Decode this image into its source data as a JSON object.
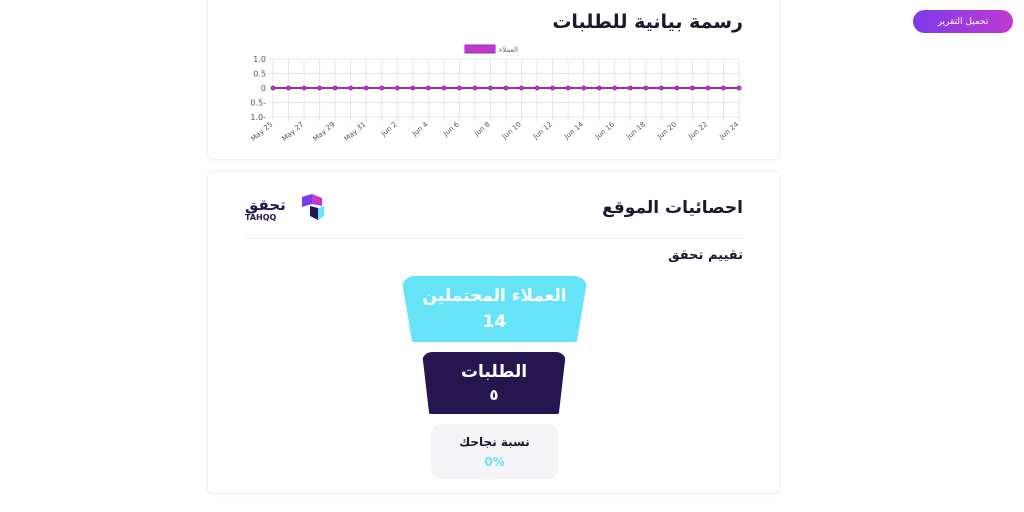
{
  "toolbar": {
    "download_label": "تحميل التقرير"
  },
  "chart_card": {
    "title": "رسمة بيانية للطلبات"
  },
  "chart_data": {
    "type": "line",
    "title": "",
    "series": [
      {
        "name": "العملاء",
        "color": "#c13ad0",
        "values": [
          0,
          0,
          0,
          0,
          0,
          0,
          0,
          0,
          0,
          0,
          0,
          0,
          0,
          0,
          0,
          0,
          0,
          0,
          0,
          0,
          0,
          0,
          0,
          0,
          0,
          0,
          0,
          0,
          0,
          0,
          0
        ]
      }
    ],
    "x": [
      "May 25",
      "May 26",
      "May 27",
      "May 28",
      "May 29",
      "May 30",
      "May 31",
      "Jun 1",
      "Jun 2",
      "Jun 3",
      "Jun 4",
      "Jun 5",
      "Jun 6",
      "Jun 7",
      "Jun 8",
      "Jun 9",
      "Jun 10",
      "Jun 11",
      "Jun 12",
      "Jun 13",
      "Jun 14",
      "Jun 15",
      "Jun 16",
      "Jun 17",
      "Jun 18",
      "Jun 19",
      "Jun 20",
      "Jun 21",
      "Jun 22",
      "Jun 23",
      "Jun 24"
    ],
    "x_tick_labels": [
      "May 25",
      "May 27",
      "May 29",
      "May 31",
      "Jun 2",
      "Jun 4",
      "Jun 6",
      "Jun 8",
      "Jun 10",
      "Jun 12",
      "Jun 14",
      "Jun 16",
      "Jun 18",
      "Jun 20",
      "Jun 22",
      "Jun 24"
    ],
    "y_tick_labels": [
      "1.0",
      "0.5",
      "0",
      "0.5-",
      "1.0-"
    ],
    "ylim": [
      -1,
      1
    ],
    "grid": true,
    "legend": "top"
  },
  "stats_card": {
    "title": "احصائيات الموقع",
    "logo": {
      "arabic": "تحقق",
      "latin": "TAHQQ"
    },
    "section_title": "تقييم تحقق",
    "funnel": {
      "leads_label": "العملاء المحتملين",
      "leads_value": "14",
      "orders_label": "الطلبات",
      "orders_value": "٥"
    },
    "conversion": {
      "label": "نسبة نجاحك",
      "value": "0%"
    }
  },
  "colors": {
    "accent_purple": "#7c3aed",
    "accent_magenta": "#c13ad0",
    "cyan": "#67e3f7",
    "navy": "#26164f"
  }
}
